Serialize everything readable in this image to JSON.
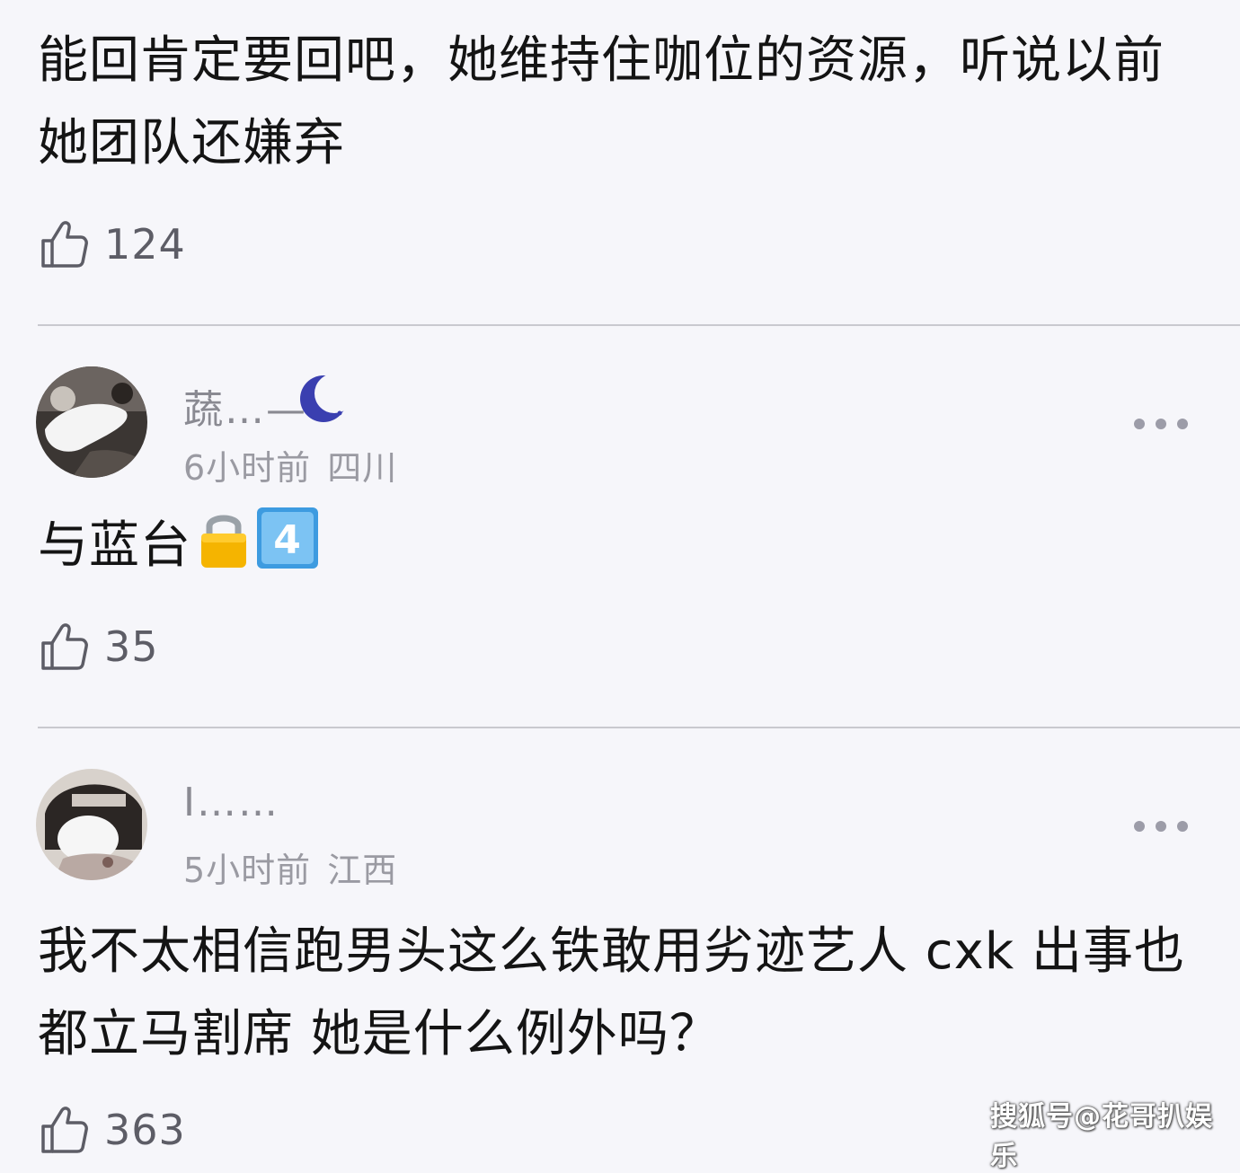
{
  "comments": [
    {
      "text": "能回肯定要回吧，她维持住咖位的资源，听说以前她团队还嫌弃",
      "likes": "124"
    },
    {
      "username": "蔬…—",
      "time": "6小时前",
      "location": "四川",
      "text": "与蓝台",
      "emojis": [
        "lock-emoji",
        "keycap-4-emoji"
      ],
      "likes": "35"
    },
    {
      "username": "I……",
      "time": "5小时前",
      "location": "江西",
      "text": "我不太相信跑男头这么铁敢用劣迹艺人 cxk 出事也都立马割席 她是什么例外吗？",
      "likes": "363"
    }
  ],
  "keycap_digit": "4",
  "watermark": "搜狐号@花哥扒娱乐",
  "colors": {
    "background": "#f6f6fa",
    "text": "#141414",
    "muted": "#9a9aa2",
    "badge": "#3a3fb0"
  }
}
